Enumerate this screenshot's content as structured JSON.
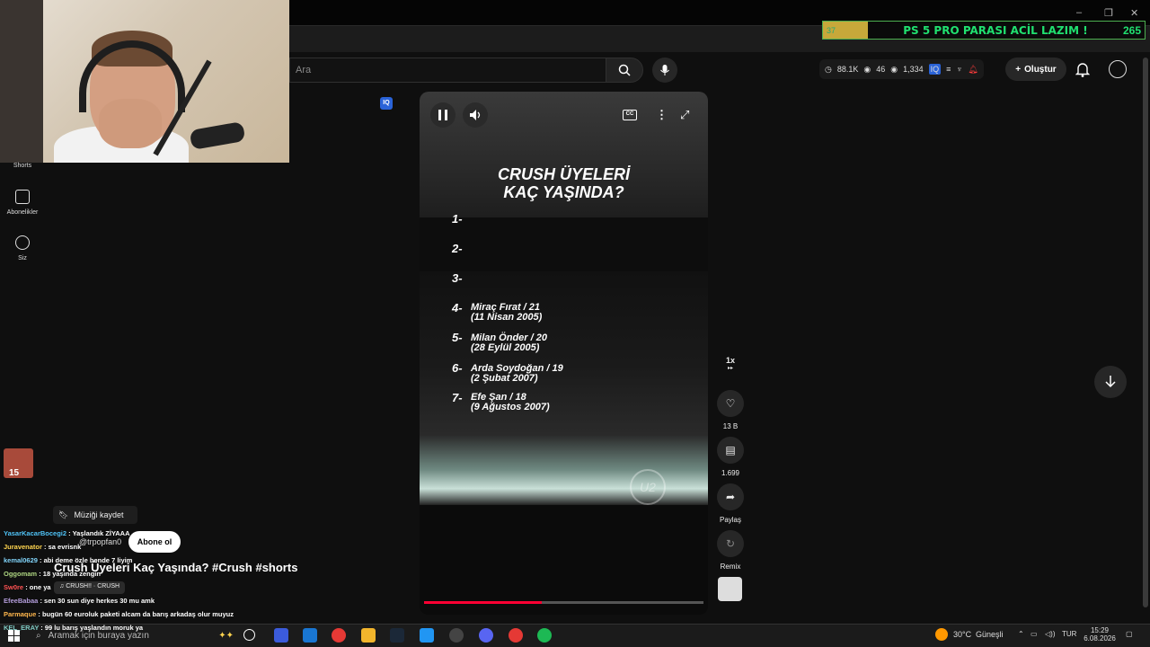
{
  "banner": {
    "goal_text": "PS 5 PRO PARASI ACİL LAZIM !",
    "count": "265",
    "progress": "37"
  },
  "window_controls": {
    "minimize": "–",
    "maximize": "❐",
    "close": "✕"
  },
  "sidebar": {
    "items": [
      {
        "label": "Shorts"
      },
      {
        "label": "Abonelikler"
      },
      {
        "label": "Siz"
      }
    ]
  },
  "search": {
    "placeholder": "Ara"
  },
  "stats": {
    "views": "88.1K",
    "viewers": "46",
    "watching": "1,334"
  },
  "header": {
    "create_label": "Oluştur"
  },
  "video": {
    "title_line1": "CRUSH ÜYELERİ",
    "title_line2": "KAÇ YAŞINDA?",
    "list": [
      {
        "rank": "1-",
        "name": "",
        "date": ""
      },
      {
        "rank": "2-",
        "name": "",
        "date": ""
      },
      {
        "rank": "3-",
        "name": "",
        "date": ""
      },
      {
        "rank": "4-",
        "name": "Miraç Fırat / 21",
        "date": "(11 Nisan 2005)"
      },
      {
        "rank": "5-",
        "name": "Milan Önder / 20",
        "date": "(28 Eylül 2005)"
      },
      {
        "rank": "6-",
        "name": "Arda Soydoğan / 19",
        "date": "(2 Şubat 2007)"
      },
      {
        "rank": "7-",
        "name": "Efe Şan / 18",
        "date": "(9 Ağustos 2007)"
      }
    ],
    "watermark": "U2",
    "progress": 0.42
  },
  "actions": {
    "speed": "1x",
    "likes": "13 B",
    "comments": "1.699",
    "share": "Paylaş",
    "remix": "Remix"
  },
  "short_info": {
    "save_music": "Müziği kaydet",
    "channel": "@trpopfan0",
    "subscribe": "Abone ol",
    "title": "Crush Üyeleri Kaç Yaşında? #Crush #shorts",
    "music": "♫ CRUSH!! · CRUSH"
  },
  "chat": {
    "badge": "15",
    "messages": [
      {
        "user": "YasarKacarBocegi2",
        "text": ": Yaşlandık ZİYAAA",
        "color": "#4fc3f7"
      },
      {
        "user": "Juravenator",
        "text": ": sa evrisnk",
        "color": "#ffd54f"
      },
      {
        "user": "kemal0629",
        "text": ": abi deme özle bende 7 liyim",
        "color": "#81d4fa"
      },
      {
        "user": "Oggomam",
        "text": ": 18 yaşında zengin",
        "color": "#aed581"
      },
      {
        "user": "Sw0re",
        "text": ": one ya",
        "color": "#ff5252"
      },
      {
        "user": "EfeeBabaa",
        "text": ": sen 30 sun diye herkes 30 mu amk",
        "color": "#b39ddb"
      },
      {
        "user": "Parmaque",
        "text": ": bugün 60 euroluk paketi alcam da barış arkadaş olur muyuz",
        "color": "#ffb74d"
      },
      {
        "user": "KEL_ERAY",
        "text": ": 99 lu barış yaşlandın moruk ya",
        "color": "#80cbc4"
      }
    ]
  },
  "taskbar": {
    "search_placeholder": "Aramak için buraya yazın",
    "weather": "30°C",
    "weather_text": "Güneşli",
    "lang": "TUR",
    "time": "15:29",
    "date": "6.08.2026"
  }
}
